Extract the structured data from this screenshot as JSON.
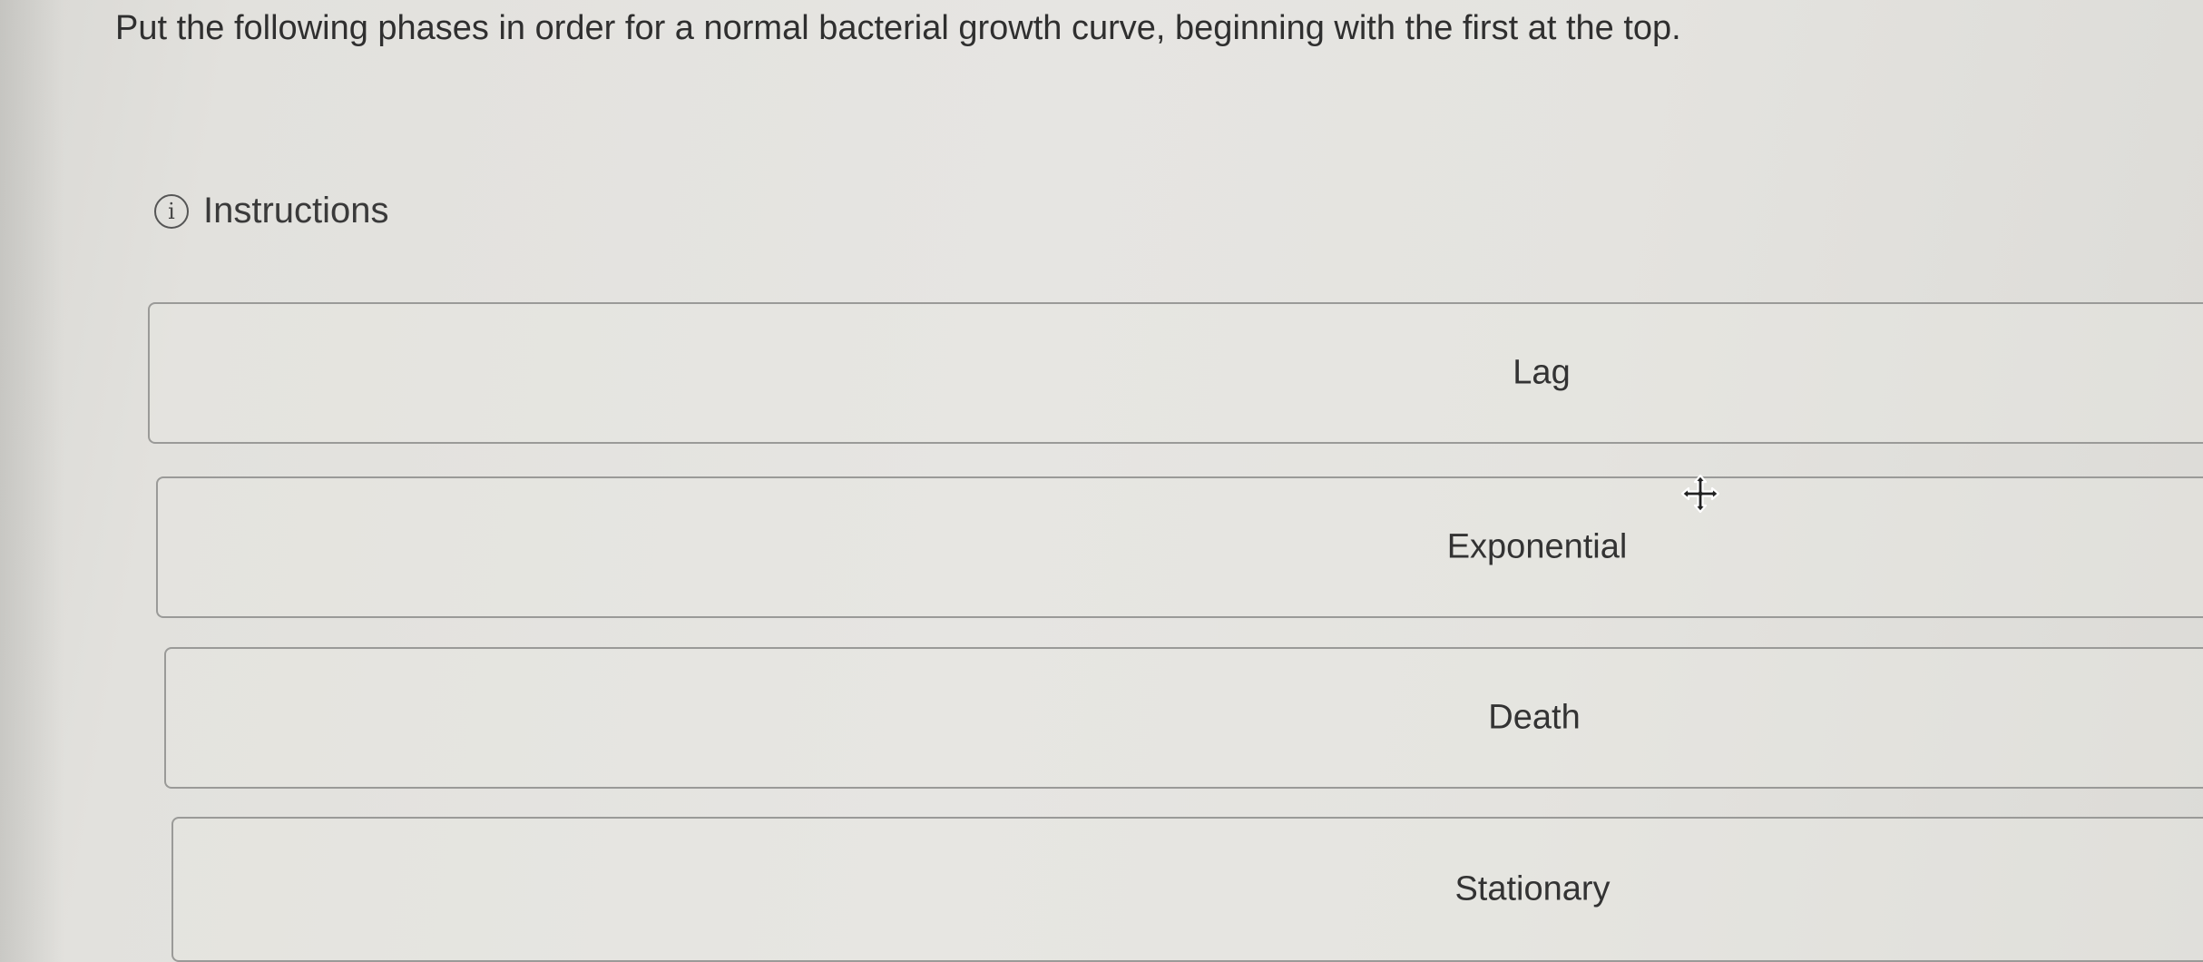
{
  "question": {
    "text": "Put the following phases in order for a normal bacterial growth curve, beginning with the first at the top."
  },
  "instructions": {
    "icon": "info-icon",
    "label": "Instructions"
  },
  "sort_items": [
    {
      "label": "Lag"
    },
    {
      "label": "Exponential"
    },
    {
      "label": "Death"
    },
    {
      "label": "Stationary"
    }
  ],
  "cursor": {
    "icon": "move-cursor-icon"
  },
  "colors": {
    "background": "#e4e3df",
    "border": "#9a9a98",
    "text": "#333333"
  }
}
